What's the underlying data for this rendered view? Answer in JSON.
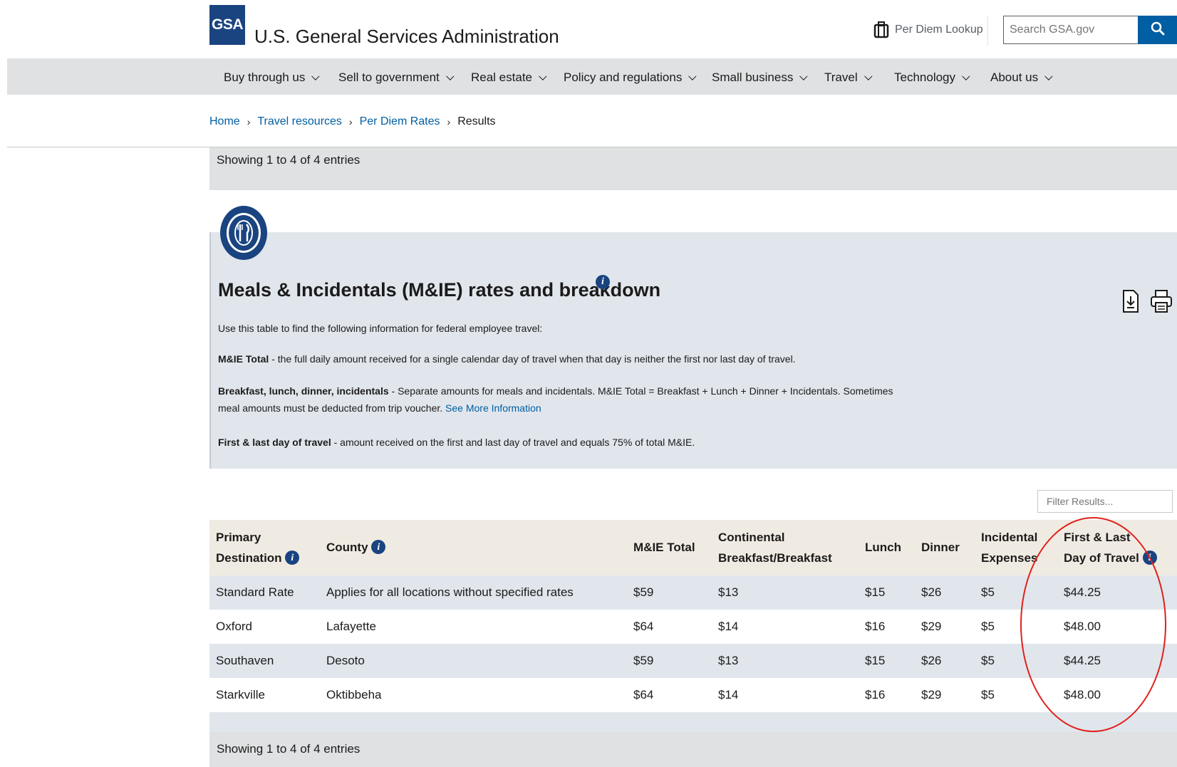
{
  "header": {
    "logo_text": "GSA",
    "site_title": "U.S. General Services Administration",
    "per_diem_link": "Per Diem Lookup",
    "search_placeholder": "Search GSA.gov"
  },
  "nav": {
    "items": [
      {
        "label": "Buy through us"
      },
      {
        "label": "Sell to government"
      },
      {
        "label": "Real estate"
      },
      {
        "label": "Policy and regulations"
      },
      {
        "label": "Small business"
      },
      {
        "label": "Travel"
      },
      {
        "label": "Technology"
      },
      {
        "label": "About us"
      }
    ]
  },
  "breadcrumb": {
    "home": "Home",
    "travel_resources": "Travel resources",
    "per_diem_rates": "Per Diem Rates",
    "results": "Results",
    "separator": "›"
  },
  "entries": {
    "top": "Showing 1 to 4 of 4 entries",
    "bottom": "Showing 1 to 4 of 4 entries"
  },
  "panel": {
    "title": "Meals & Incidentals (M&IE) rates and breakdown",
    "intro": "Use this table to find the following information for federal employee travel:",
    "mie_total_term": "M&IE Total",
    "mie_total_text": " - the full daily amount received for a single calendar day of travel when that day is neither the first nor last day of travel.",
    "breakdown_term": "Breakfast, lunch, dinner, incidentals",
    "breakdown_text": " - Separate amounts for meals and incidentals. M&IE Total = Breakfast + Lunch + Dinner + Incidentals. Sometimes meal amounts must be deducted from trip voucher. ",
    "see_more_link": "See More Information",
    "first_last_term": "First & last day of travel",
    "first_last_text": " - amount received on the first and last day of travel and equals 75% of total M&IE."
  },
  "filter": {
    "placeholder": "Filter Results..."
  },
  "table": {
    "headers": {
      "primary_destination_1": "Primary",
      "primary_destination_2": "Destination",
      "county": "County",
      "mie_total": "M&IE Total",
      "breakfast_1": "Continental",
      "breakfast_2": "Breakfast/Breakfast",
      "lunch": "Lunch",
      "dinner": "Dinner",
      "incidental_1": "Incidental",
      "incidental_2": "Expenses",
      "first_last_1": "First & Last",
      "first_last_2": "Day of Travel"
    },
    "rows": [
      {
        "destination": "Standard Rate",
        "county": "Applies for all locations without specified rates",
        "total": "$59",
        "breakfast": "$13",
        "lunch": "$15",
        "dinner": "$26",
        "incidental": "$5",
        "first_last": "$44.25"
      },
      {
        "destination": "Oxford",
        "county": "Lafayette",
        "total": "$64",
        "breakfast": "$14",
        "lunch": "$16",
        "dinner": "$29",
        "incidental": "$5",
        "first_last": "$48.00"
      },
      {
        "destination": "Southaven",
        "county": "Desoto",
        "total": "$59",
        "breakfast": "$13",
        "lunch": "$15",
        "dinner": "$26",
        "incidental": "$5",
        "first_last": "$44.25"
      },
      {
        "destination": "Starkville",
        "county": "Oktibbeha",
        "total": "$64",
        "breakfast": "$14",
        "lunch": "$16",
        "dinner": "$29",
        "incidental": "$5",
        "first_last": "$48.00"
      }
    ]
  },
  "colors": {
    "brand_blue": "#1a4480",
    "link_blue": "#005ea2",
    "nav_gray": "#dfe1e2",
    "panel_blue_gray": "#e1e6ec",
    "table_header_beige": "#f0ebe2",
    "highlight_red": "#e0201b"
  },
  "icons": {
    "per_diem": "luggage-icon",
    "search": "magnifier-icon",
    "meal": "fork-knife-plate-icon",
    "info": "info-icon",
    "download": "download-icon",
    "print": "printer-icon"
  }
}
